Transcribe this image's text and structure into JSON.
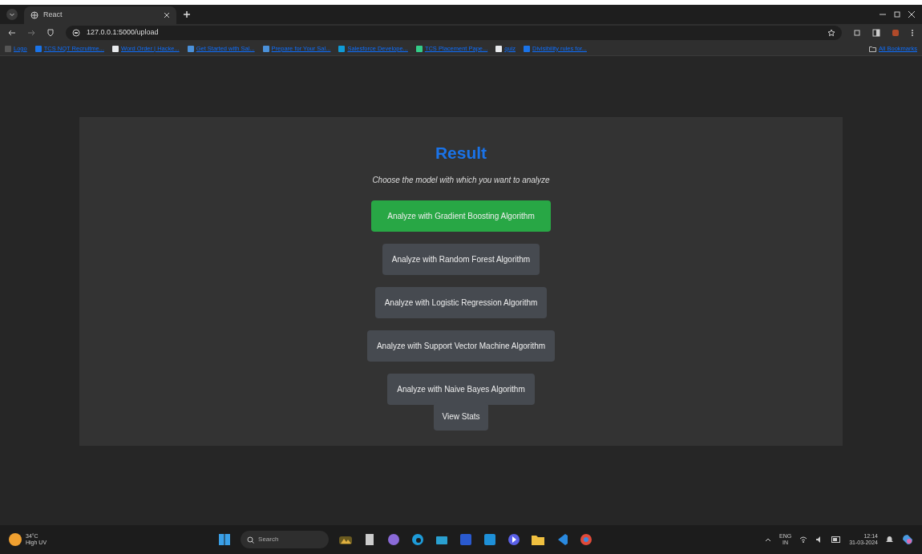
{
  "browser": {
    "tabs": [
      {
        "title": "React",
        "selected": true
      }
    ],
    "address": "127.0.0.1:5000/upload",
    "bookmarks": [
      "Logo",
      "TCS NQT Recruitme...",
      "Word Order | Hacke...",
      "Get Started with Sal...",
      "Prepare for Your Sal...",
      "Salesforce Develope...",
      "TCS Placement Pape...",
      "quiz",
      "Divisibility rules for..."
    ],
    "all_bookmarks": "All Bookmarks"
  },
  "result": {
    "title": "Result",
    "subtitle": "Choose the model with which you want to analyze",
    "buttons": [
      {
        "label": "Analyze with Gradient Boosting Algorithm",
        "selected": true
      },
      {
        "label": "Analyze with Random Forest Algorithm",
        "selected": false
      },
      {
        "label": "Analyze with Logistic Regression Algorithm",
        "selected": false
      },
      {
        "label": "Analyze with Support Vector Machine Algorithm",
        "selected": false
      },
      {
        "label": "Analyze with Naive Bayes Algorithm",
        "selected": false
      }
    ],
    "stats_button": "View Stats"
  },
  "taskbar": {
    "weather": {
      "temp": "34°C",
      "condition": "High UV"
    },
    "search": "Search",
    "language": [
      "ENG",
      "IN"
    ],
    "time": "12:14",
    "date": "31-03-2024"
  }
}
